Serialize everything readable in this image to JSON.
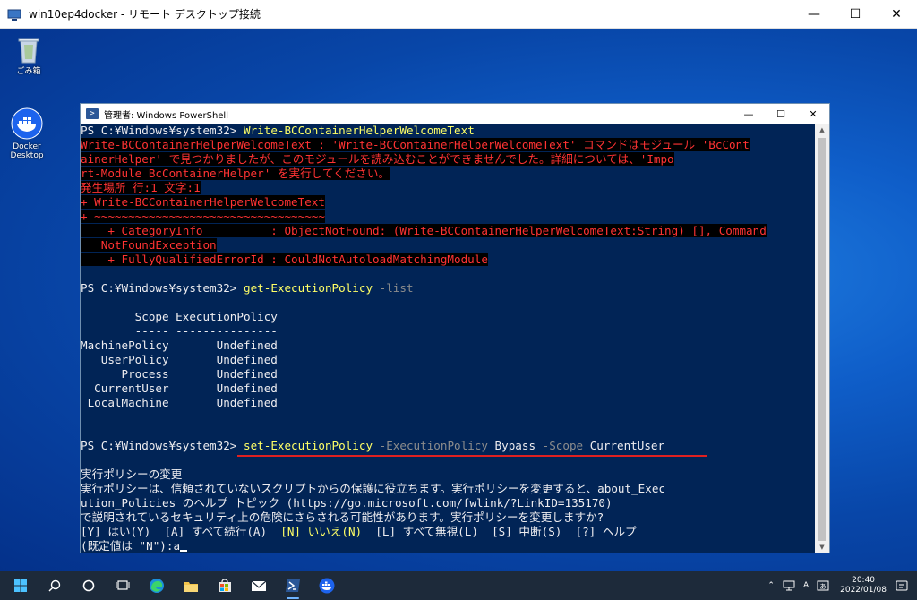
{
  "rdp": {
    "title": "win10ep4docker - リモート デスクトップ接続",
    "minimize": "—",
    "maximize": "☐",
    "close": "✕"
  },
  "desktop": {
    "recycle_bin": "ごみ箱",
    "docker_line1": "Docker",
    "docker_line2": "Desktop"
  },
  "powershell": {
    "title": "管理者: Windows PowerShell",
    "minimize": "—",
    "maximize": "☐",
    "close": "✕",
    "console": {
      "l1_prompt": "PS C:¥Windows¥system32> ",
      "l1_cmd": "Write-BCContainerHelperWelcomeText",
      "err1": "Write-BCContainerHelperWelcomeText : 'Write-BCContainerHelperWelcomeText' コマンドはモジュール 'BcCont",
      "err2": "ainerHelper' で見つかりましたが、このモジュールを読み込むことができませんでした。詳細については、'Impo",
      "err3": "rt-Module BcContainerHelper' を実行してください。",
      "err4": "発生場所 行:1 文字:1",
      "err5": "+ Write-BCContainerHelperWelcomeText",
      "err6": "+ ~~~~~~~~~~~~~~~~~~~~~~~~~~~~~~~~~~",
      "err7": "    + CategoryInfo          : ObjectNotFound: (Write-BCContainerHelperWelcomeText:String) [], Command",
      "err8": "   NotFoundException",
      "err9": "    + FullyQualifiedErrorId : CouldNotAutoloadMatchingModule",
      "l2_prompt": "PS C:¥Windows¥system32> ",
      "l2_cmd": "get-ExecutionPolicy",
      "l2_param": " -list",
      "hdr1": "        Scope ExecutionPolicy",
      "hdr2": "        ----- ---------------",
      "rows": [
        "MachinePolicy       Undefined",
        "   UserPolicy       Undefined",
        "      Process       Undefined",
        "  CurrentUser       Undefined",
        " LocalMachine       Undefined"
      ],
      "l3_prompt": "PS C:¥Windows¥system32> ",
      "l3_cmd": "set-ExecutionPolicy",
      "l3_p1": " -ExecutionPolicy",
      "l3_v1": " Bypass",
      "l3_p2": " -Scope",
      "l3_v2": " CurrentUser",
      "msg1": "実行ポリシーの変更",
      "msg2": "実行ポリシーは、信頼されていないスクリプトからの保護に役立ちます。実行ポリシーを変更すると、about_Exec",
      "msg3": "ution_Policies のヘルプ トピック (https://go.microsoft.com/fwlink/?LinkID=135170)",
      "msg4": "で説明されているセキュリティ上の危険にさらされる可能性があります。実行ポリシーを変更しますか?",
      "choice_a": "[Y] はい(Y)  [A] すべて続行(A)  ",
      "choice_n": "[N] いいえ(N)",
      "choice_b": "  [L] すべて無視(L)  [S] 中断(S)  [?] ヘルプ",
      "default_prompt": "(既定値は \"N\"):a"
    }
  },
  "taskbar": {
    "ime1": "A",
    "time": "20:40",
    "date": "2022/01/08"
  }
}
